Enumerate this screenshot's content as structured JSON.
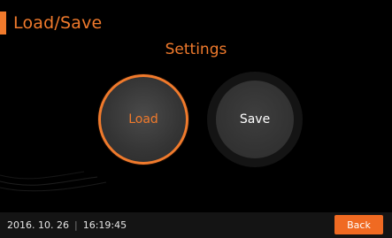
{
  "header": {
    "title": "Load/Save"
  },
  "main": {
    "subtitle": "Settings",
    "load_label": "Load",
    "save_label": "Save"
  },
  "status_bar": {
    "date": "2016. 10. 26",
    "separator": "|",
    "time": "16:19:45",
    "back_label": "Back"
  },
  "colors": {
    "accent": "#f07a2c",
    "background": "#000000",
    "button_fill": "#353535",
    "back_button": "#f06a22"
  }
}
